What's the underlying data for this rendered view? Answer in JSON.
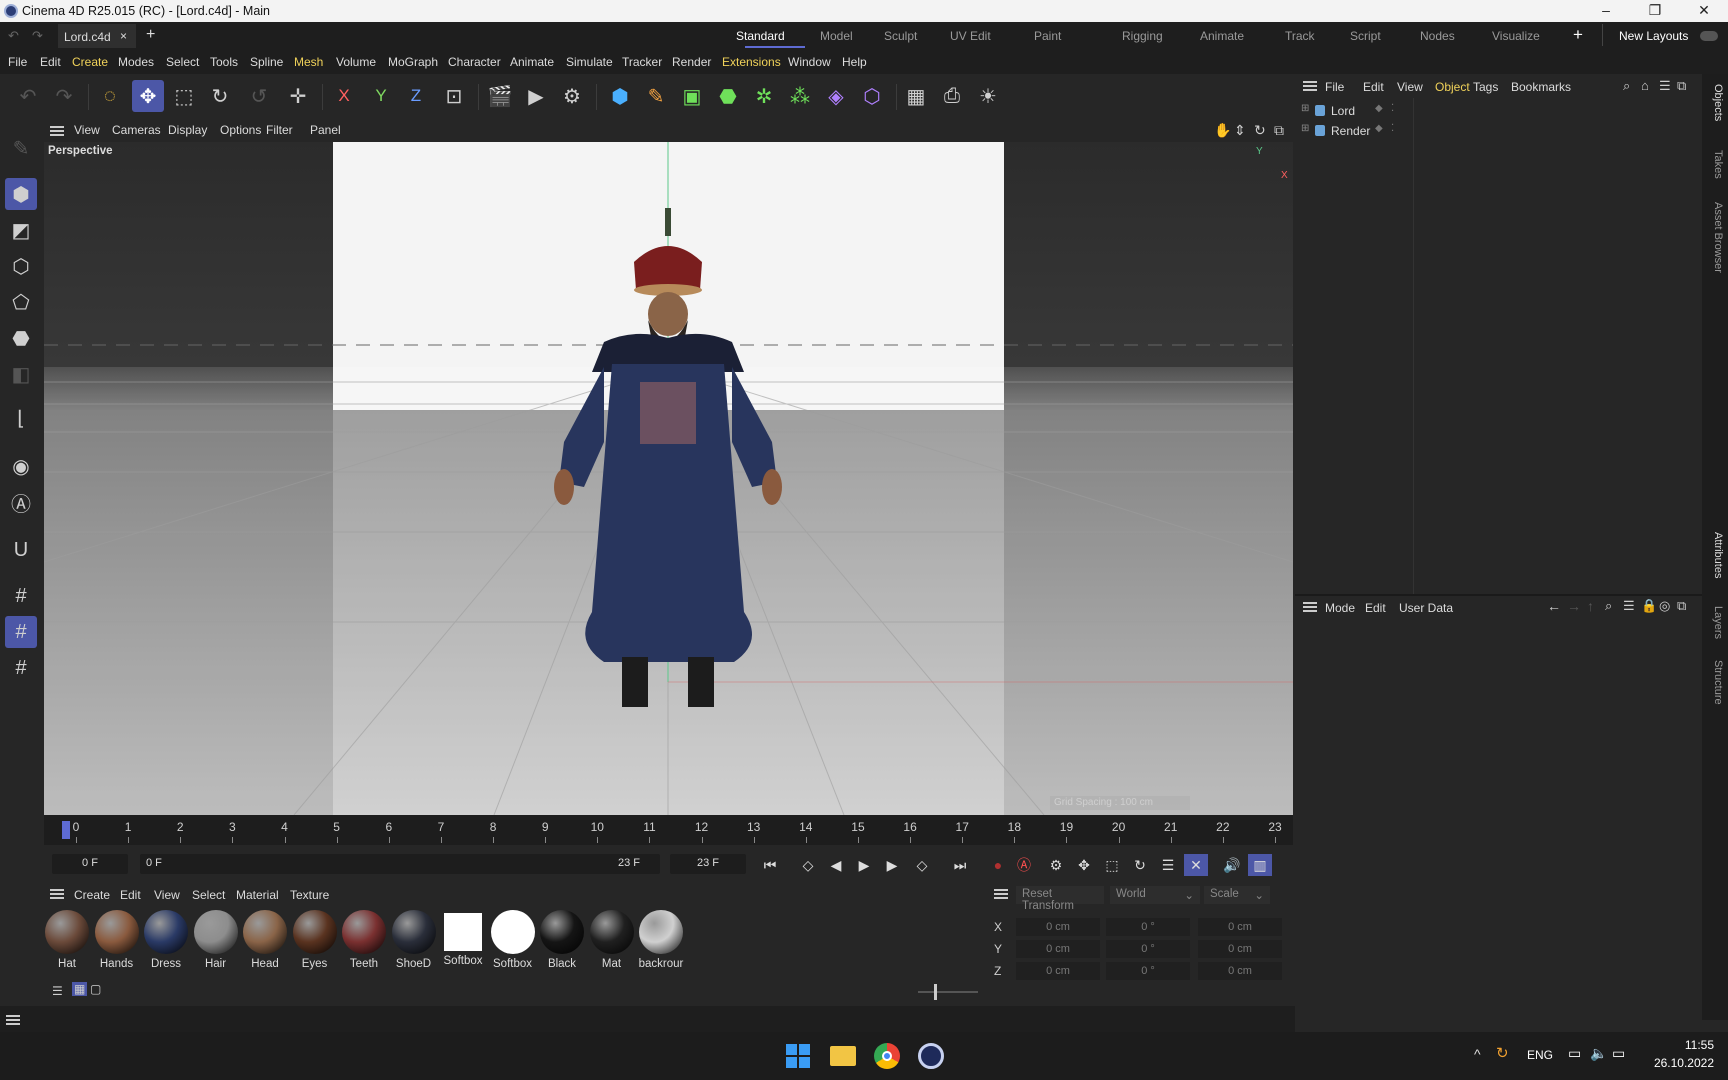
{
  "window": {
    "title": "Cinema 4D R25.015 (RC) - [Lord.c4d] - Main"
  },
  "doc_tab": {
    "label": "Lord.c4d",
    "close": "×",
    "add": "+"
  },
  "layouts": [
    "Standard",
    "Model",
    "Sculpt",
    "UV Edit",
    "Paint",
    "Rigging",
    "Animate",
    "Track",
    "Script",
    "Nodes",
    "Visualize"
  ],
  "layout_add": "+",
  "new_layouts": "New Layouts",
  "menu": [
    "File",
    "Edit",
    "Create",
    "Modes",
    "Select",
    "Tools",
    "Spline",
    "Mesh",
    "Volume",
    "MoGraph",
    "Character",
    "Animate",
    "Simulate",
    "Tracker",
    "Render",
    "Extensions",
    "Window",
    "Help"
  ],
  "axis_buttons": {
    "x": "X",
    "y": "Y",
    "z": "Z"
  },
  "viewport": {
    "menu": [
      "View",
      "Cameras",
      "Display",
      "Options",
      "Filter",
      "Panel"
    ],
    "camera_label": "Perspective",
    "grid_spacing": "Grid Spacing : 100 cm",
    "axis_y": "Y",
    "axis_x": "X"
  },
  "timeline": {
    "ticks": [
      "0",
      "1",
      "2",
      "3",
      "4",
      "5",
      "6",
      "7",
      "8",
      "9",
      "10",
      "11",
      "12",
      "13",
      "14",
      "15",
      "16",
      "17",
      "18",
      "19",
      "20",
      "21",
      "22",
      "23"
    ],
    "current_frame": "0 F",
    "range_start": "0 F",
    "range_end": "23 F",
    "end_frame": "23 F"
  },
  "materials": {
    "menu": [
      "Create",
      "Edit",
      "View",
      "Select",
      "Material",
      "Texture"
    ],
    "items": [
      {
        "name": "Hat",
        "color": "#6b4a3a"
      },
      {
        "name": "Hands",
        "color": "#8a5a3e"
      },
      {
        "name": "Dress",
        "color": "#2a3a66"
      },
      {
        "name": "Hair",
        "color": "#8d8d8d"
      },
      {
        "name": "Head",
        "color": "#8a6448"
      },
      {
        "name": "Eyes",
        "color": "#5a3320"
      },
      {
        "name": "Teeth",
        "color": "#7a3030"
      },
      {
        "name": "ShoeD",
        "color": "#2a2e3a"
      },
      {
        "name": "Softbox",
        "color": "#ffffff"
      },
      {
        "name": "Softbox",
        "color": "#ffffff"
      },
      {
        "name": "Black",
        "color": "#151515"
      },
      {
        "name": "Mat",
        "color": "#202020"
      },
      {
        "name": "backrour",
        "color": "#d0d0d0"
      }
    ]
  },
  "coords": {
    "reset": "Reset Transform",
    "space": "World",
    "mode": "Scale",
    "rows": [
      {
        "axis": "X",
        "pos": "0 cm",
        "rot": "0 °",
        "scale": "0 cm"
      },
      {
        "axis": "Y",
        "pos": "0 cm",
        "rot": "0 °",
        "scale": "0 cm"
      },
      {
        "axis": "Z",
        "pos": "0 cm",
        "rot": "0 °",
        "scale": "0 cm"
      }
    ]
  },
  "objects": {
    "menu": [
      "File",
      "Edit",
      "View",
      "Object",
      "Tags",
      "Bookmarks"
    ],
    "items": [
      "Lord",
      "Render"
    ]
  },
  "attributes": {
    "menu": [
      "Mode",
      "Edit",
      "User Data"
    ]
  },
  "side_tabs": [
    "Objects",
    "Takes",
    "Asset Browser",
    "Attributes",
    "Layers",
    "Structure"
  ],
  "taskbar": {
    "lang": "ENG",
    "time": "11:55",
    "date": "26.10.2022"
  }
}
